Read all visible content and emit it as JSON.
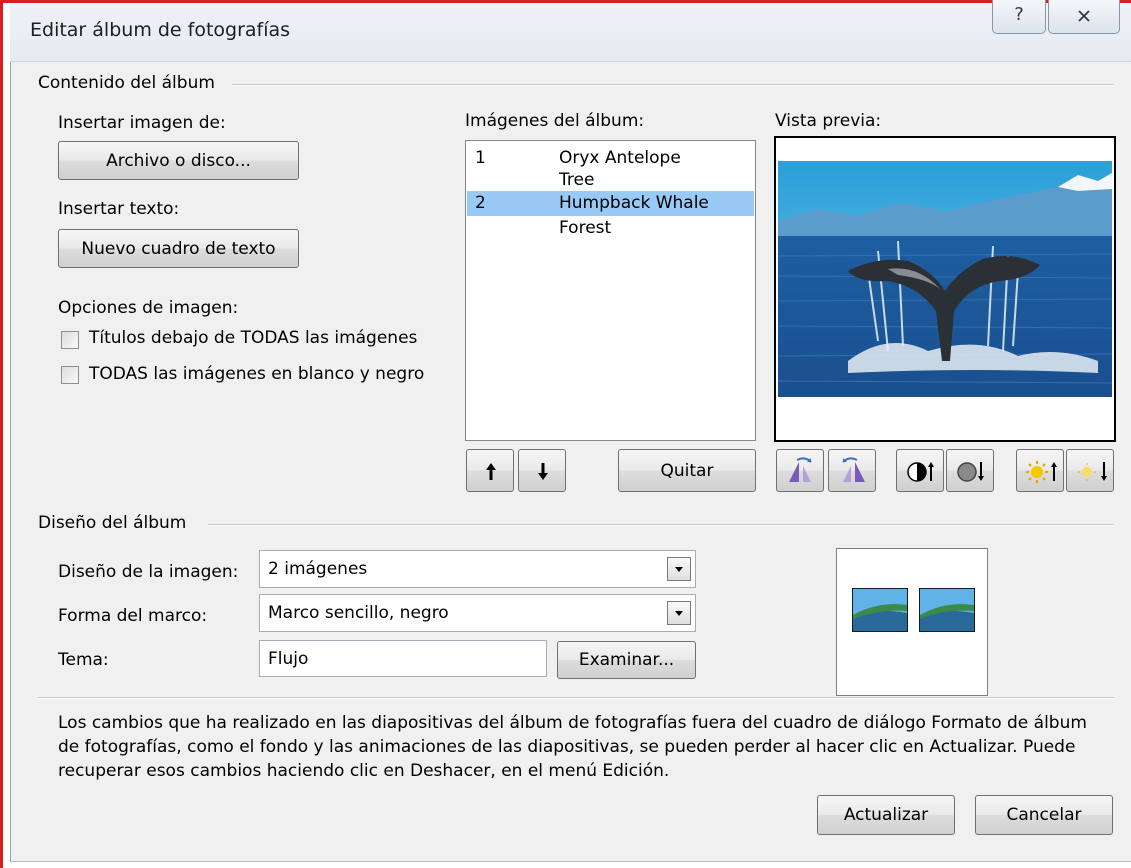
{
  "window": {
    "title": "Editar álbum de fotografías",
    "help_glyph": "?",
    "close_glyph": "X"
  },
  "contenido": {
    "group_label": "Contenido del álbum",
    "insert_image_label": "Insertar imagen de:",
    "file_button": "Archivo o disco...",
    "insert_text_label": "Insertar texto:",
    "new_textbox_button": "Nuevo cuadro de texto",
    "options_label": "Opciones de imagen:",
    "captions_label": "Títulos debajo de TODAS las imágenes",
    "blackwhite_label": "TODAS las imágenes en blanco y negro",
    "captions_checked": false,
    "blackwhite_checked": false
  },
  "images": {
    "label": "Imágenes del álbum:",
    "items": [
      {
        "num": "1",
        "name": "Oryx Antelope",
        "selected": false
      },
      {
        "num": "",
        "name": "Tree",
        "selected": false
      },
      {
        "num": "2",
        "name": "Humpback Whale",
        "selected": true
      },
      {
        "num": "",
        "name": "Forest",
        "selected": false
      }
    ],
    "remove_button": "Quitar"
  },
  "preview": {
    "label": "Vista previa:"
  },
  "diseno": {
    "group_label": "Diseño del álbum",
    "layout_label": "Diseño de la imagen:",
    "layout_value": "2 imágenes",
    "frame_label": "Forma del marco:",
    "frame_value": "Marco sencillo, negro",
    "theme_label": "Tema:",
    "theme_value": "Flujo",
    "browse_button": "Examinar..."
  },
  "note": "Los cambios que ha realizado en las diapositivas del álbum de fotografías fuera del cuadro de diálogo Formato de álbum de fotografías, como el fondo y las animaciones de las diapositivas, se pueden perder al hacer clic en Actualizar. Puede recuperar esos cambios haciendo clic en Deshacer, en el menú Edición.",
  "footer": {
    "update_button": "Actualizar",
    "cancel_button": "Cancelar"
  },
  "icons": {
    "move_up": "arrow-up-icon",
    "move_down": "arrow-down-icon",
    "rotate_left": "rotate-left-icon",
    "rotate_right": "rotate-right-icon",
    "contrast_up": "contrast-up-icon",
    "contrast_down": "contrast-down-icon",
    "brightness_up": "brightness-up-icon",
    "brightness_down": "brightness-down-icon"
  },
  "colors": {
    "frame_accent": "#d42020",
    "selection": "#99c9f5",
    "dialog_bg": "#f0f0f0"
  }
}
